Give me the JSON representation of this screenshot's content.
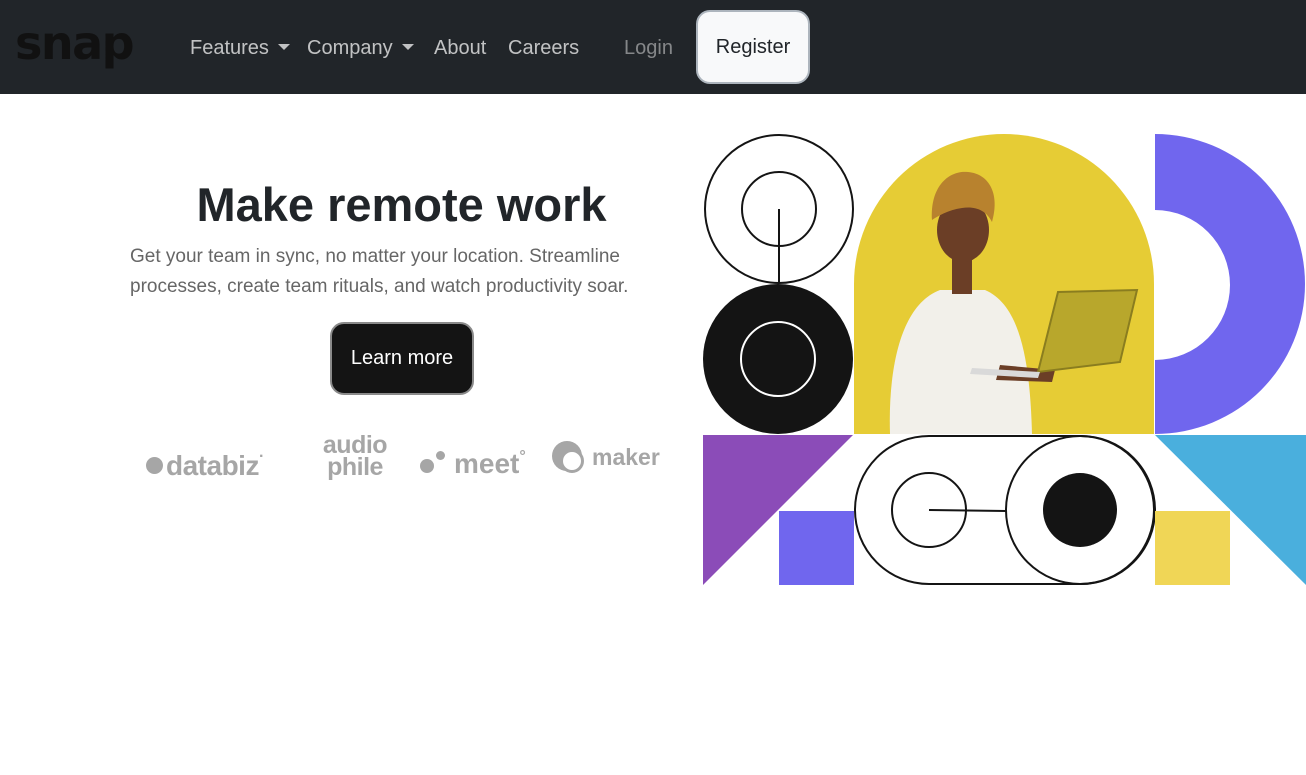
{
  "navbar": {
    "logo": "snap",
    "links": [
      {
        "label": "Features",
        "dropdown": true
      },
      {
        "label": "Company",
        "dropdown": true
      },
      {
        "label": "About"
      },
      {
        "label": "Careers"
      }
    ],
    "login_label": "Login",
    "register_label": "Register"
  },
  "hero": {
    "title": "Make remote work",
    "description": "Get your team in sync, no matter your location. Streamline processes, create team rituals, and watch productivity soar.",
    "cta_label": "Learn more"
  },
  "clients": {
    "databiz": "databiz",
    "databiz_mark": "·",
    "audiophile_top": "audio",
    "audiophile_bottom": "phile",
    "meet": "meet",
    "meet_mark": "°",
    "maker": "maker"
  },
  "colors": {
    "navbar_bg": "#212529",
    "cta_bg": "#141414",
    "logo_gray": "#a6a6a6",
    "yellow": "#e6cc35",
    "violet": "#7066ee",
    "purple": "#8b4cb8",
    "sky_blue": "#4aafdd",
    "light_yellow": "#f0d656"
  }
}
